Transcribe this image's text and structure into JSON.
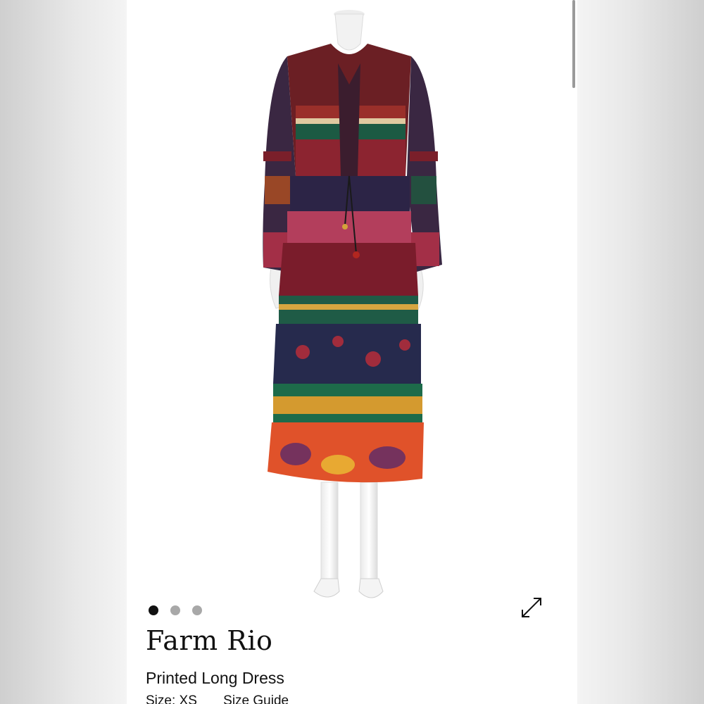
{
  "product": {
    "brand": "Farm Rio",
    "name": "Printed Long Dress",
    "size_label": "Size: XS",
    "size_guide_label": "Size Guide"
  },
  "gallery": {
    "image_count": 3,
    "active_index": 0,
    "expand_icon": "expand-arrows-icon"
  },
  "colors": {
    "accent_dark": "#111111",
    "dot_inactive": "#a8a8a8"
  }
}
